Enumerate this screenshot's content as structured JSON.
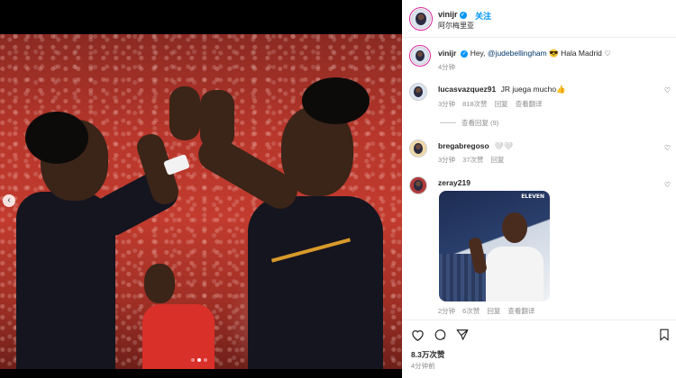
{
  "header": {
    "username": "vinijr",
    "follow_label": "关注",
    "location": "阿尔梅里亚"
  },
  "caption": {
    "username": "vinijr",
    "mention": "@judebellingham",
    "text_before": "Hey,",
    "text_after": "Hala Madrid",
    "emoji": "😎",
    "time": "4分钟"
  },
  "comments": [
    {
      "username": "lucasvazquez91",
      "text": "JR juega mucho👍",
      "time": "3分钟",
      "likes": "818次赞",
      "reply": "回复",
      "translate": "查看翻译"
    },
    {
      "username": "bregabregoso",
      "text": "🤍🤍",
      "time": "3分钟",
      "likes": "37次赞",
      "reply": "回复"
    },
    {
      "username": "zeray219",
      "gif_label": "ELEVEN",
      "time": "2分钟",
      "likes": "6次赞",
      "reply": "回复",
      "translate": "查看翻译"
    }
  ],
  "view_replies": "查看回复 (9)",
  "likes_count": "8.3万次赞",
  "post_time": "4分钟前",
  "icons": {
    "like": "heart-icon",
    "comment": "comment-icon",
    "share": "share-icon",
    "save": "bookmark-icon"
  }
}
